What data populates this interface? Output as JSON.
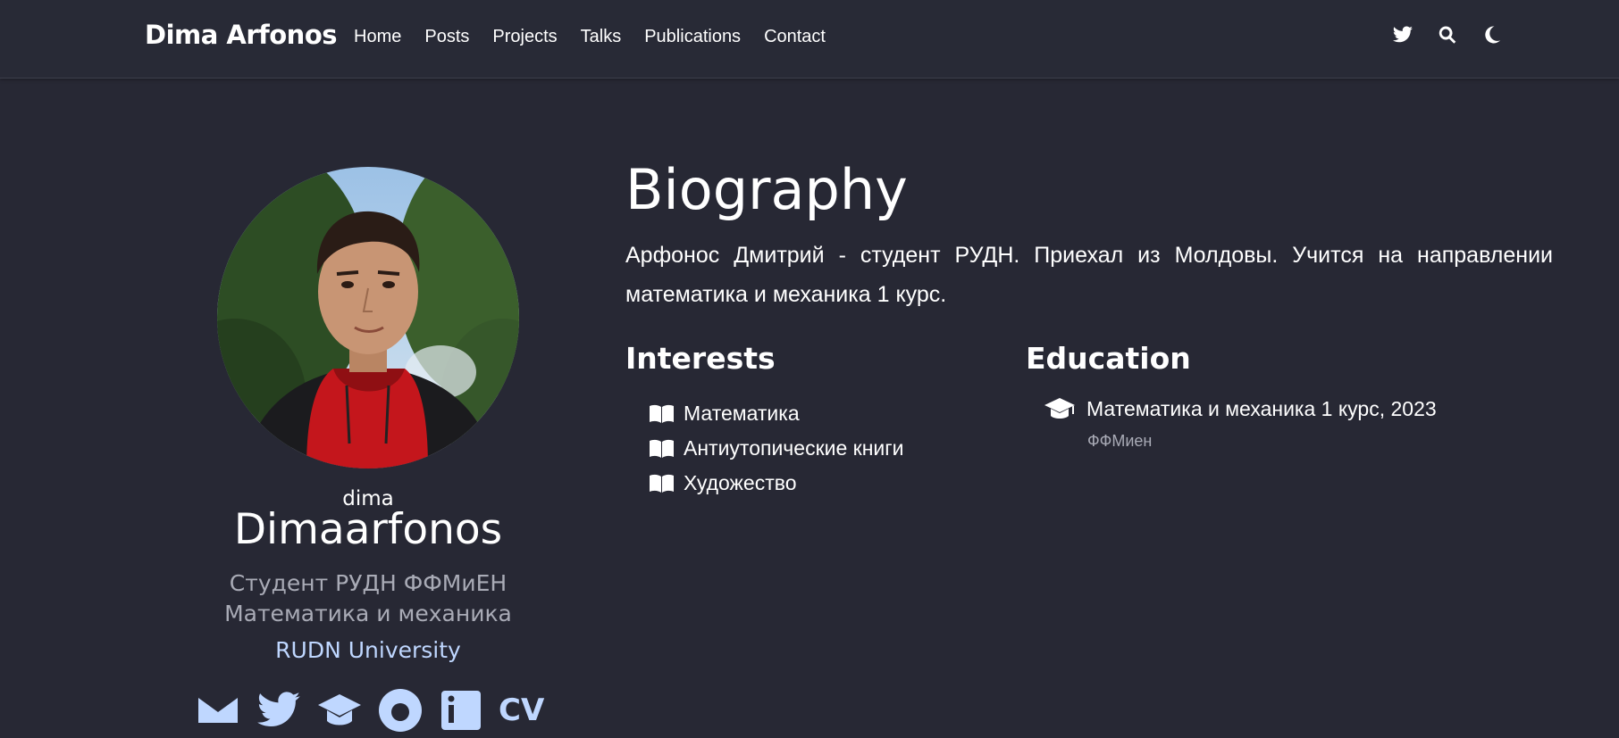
{
  "navbar": {
    "brand": "Dima Arfonos",
    "links": [
      "Home",
      "Posts",
      "Projects",
      "Talks",
      "Publications",
      "Contact"
    ],
    "icons": [
      "twitter-icon",
      "search-icon",
      "moon-icon"
    ]
  },
  "profile": {
    "small_name": "dima",
    "name": "Dimaarfonos",
    "role_line1": "Студент РУДН ФФМиЕН",
    "role_line2": "Математика и механика",
    "organization": "RUDN University",
    "social": [
      "email-icon",
      "twitter-icon",
      "graduation-cap-icon",
      "github-icon",
      "linkedin-icon"
    ],
    "cv_label": "CV"
  },
  "biography": {
    "title": "Biography",
    "text": "Арфонос Дмитрий - студент РУДН. Приехал из Молдовы. Учится на направлении математика и механика 1 курс."
  },
  "interests": {
    "title": "Interests",
    "items": [
      "Математика",
      "Антиутопические книги",
      "Художество"
    ]
  },
  "education": {
    "title": "Education",
    "items": [
      {
        "course": "Математика и механика 1 курс, 2023",
        "institution": "ФФМиен"
      }
    ]
  },
  "colors": {
    "background": "#272834",
    "navbar": "#282a36",
    "muted_text": "#a9abb6",
    "link": "#bfd7ff"
  }
}
